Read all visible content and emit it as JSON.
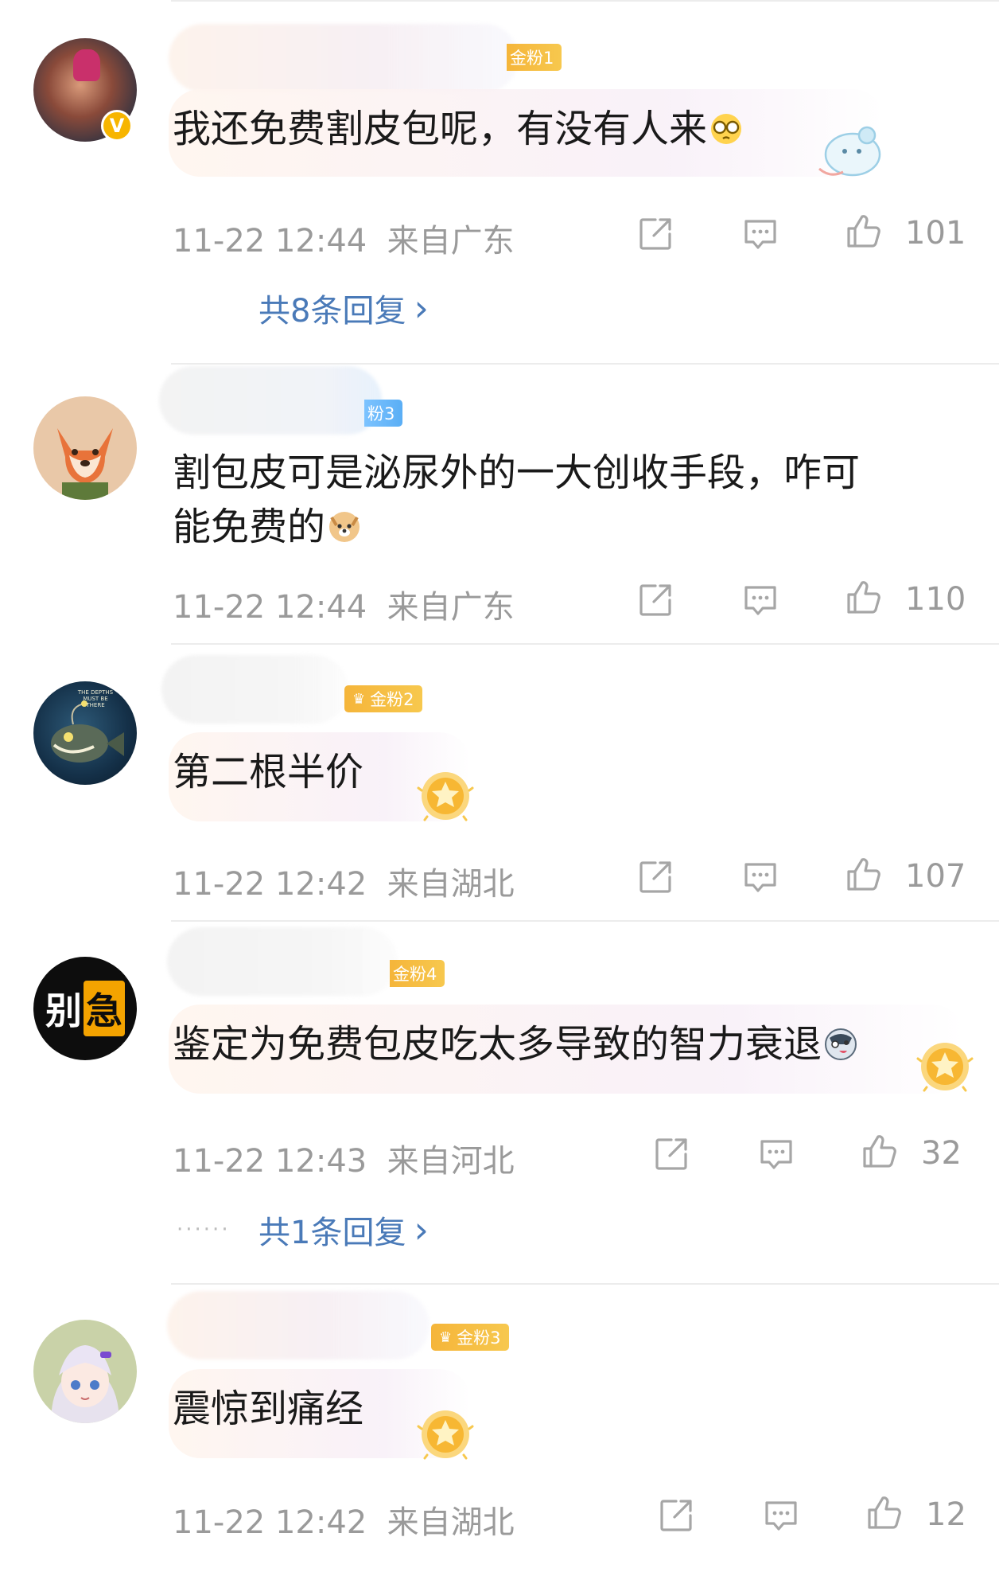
{
  "comments": [
    {
      "fan_badge": "金粉1",
      "verified": "V",
      "text": "我还免费割皮包呢，有没有人来",
      "time": "11-22 12:44",
      "location": "来自广东",
      "likes": "101",
      "replies": "共8条回复",
      "chevron": "›"
    },
    {
      "fan_badge": "粉3",
      "text_line1": "割包皮可是泌尿外的一大创收手段，咋可",
      "text_line2": "能免费的",
      "time": "11-22 12:44",
      "location": "来自广东",
      "likes": "110"
    },
    {
      "fan_badge": "金粉2",
      "text": "第二根半价",
      "avatar_text": "THE DEPTHS MUST BE THERE",
      "time": "11-22 12:42",
      "location": "来自湖北",
      "likes": "107"
    },
    {
      "fan_badge": "金粉4",
      "avatar_chars": [
        "别",
        "急"
      ],
      "text": "鉴定为免费包皮吃太多导致的智力衰退",
      "time": "11-22 12:43",
      "location": "来自河北",
      "likes": "32",
      "dots": "······",
      "replies": "共1条回复",
      "chevron": "›"
    },
    {
      "fan_badge": "金粉3",
      "text": "震惊到痛经",
      "time": "11-22 12:42",
      "location": "来自湖北",
      "likes": "12"
    }
  ],
  "icons": {
    "share": "share-icon",
    "comment": "comment-icon",
    "like": "thumbs-up-icon"
  },
  "colors": {
    "reply_link": "#4a7ab8",
    "meta_gray": "#9a9a9a",
    "gold_badge": "#f5b53a",
    "blue_badge": "#5aaef5"
  }
}
